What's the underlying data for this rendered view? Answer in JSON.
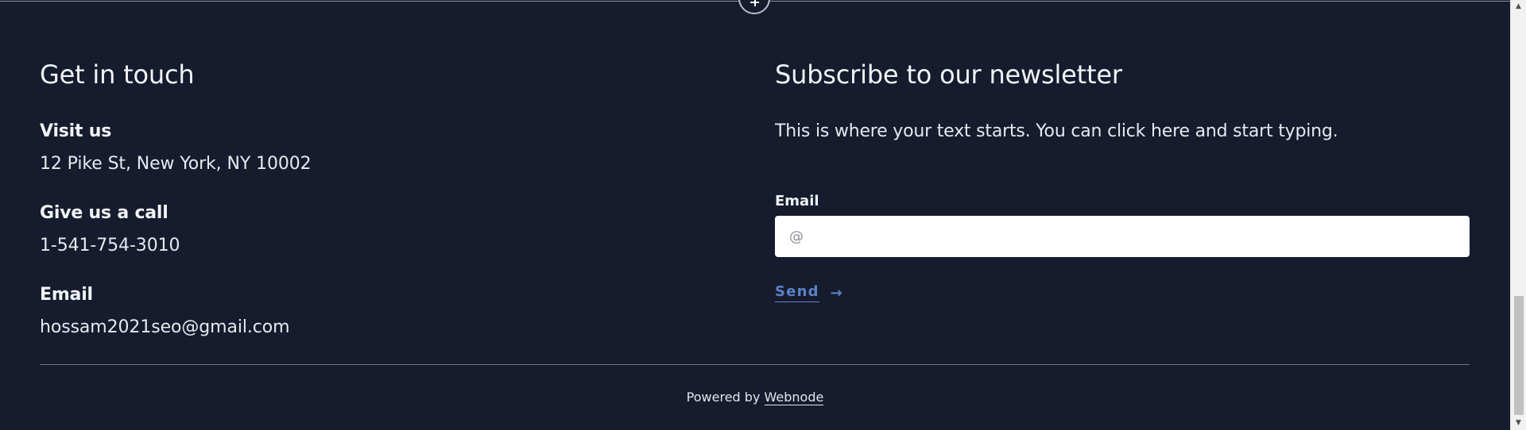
{
  "contact": {
    "title": "Get in touch",
    "visit_label": "Visit us",
    "visit_value": "12 Pike St, New York, NY 10002",
    "call_label": "Give us a call",
    "call_value": "1-541-754-3010",
    "email_label": "Email",
    "email_value": "hossam2021seo@gmail.com"
  },
  "newsletter": {
    "title": "Subscribe to our newsletter",
    "text": "This is where your text starts. You can click here and start typing.",
    "field_label": "Email",
    "input_placeholder": "@",
    "input_value": "",
    "send_label": "Send",
    "send_arrow": "→"
  },
  "footer": {
    "powered_prefix": "Powered by",
    "powered_link": "Webnode"
  },
  "add_section": {
    "symbol": "+"
  },
  "scrollbar": {
    "up_arrow": "▲",
    "down_arrow": "▼"
  },
  "colors": {
    "background": "#161c2d",
    "accent": "#5d83c8",
    "text": "#f1f3f7"
  }
}
